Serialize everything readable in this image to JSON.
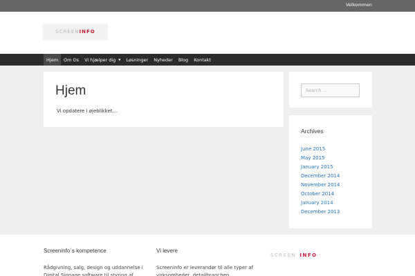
{
  "topbar": {
    "welcome_link": "Velkommen"
  },
  "logo": {
    "part1": "SCREEN",
    "part2": "INFO"
  },
  "nav": {
    "items": [
      {
        "label": "Hjem"
      },
      {
        "label": "Om Os"
      },
      {
        "label": "Vi hjælper dig"
      },
      {
        "label": "Løsninger"
      },
      {
        "label": "Nyheder"
      },
      {
        "label": "Blog"
      },
      {
        "label": "Kontakt"
      }
    ],
    "active": "Hjem",
    "caret": "▼"
  },
  "main": {
    "title": "Hjem",
    "body": "Vi opdatere i øjeblikket..."
  },
  "sidebar": {
    "search": {
      "placeholder": "Search ..."
    },
    "archives": {
      "title": "Archives",
      "items": [
        "June 2015",
        "May 2015",
        "January 2015",
        "December 2014",
        "November 2014",
        "October 2014",
        "January 2014",
        "December 2013"
      ]
    }
  },
  "footer": {
    "col1": {
      "title": "Screeninfo´s kompetence",
      "text": "Rådgivning, salg, design og uddannelse i Digital Signage software til styring af"
    },
    "col2": {
      "title": "Vi levere",
      "text": "Screeninfo er leverandør til alle typer af virksomheder, detailbranchen"
    },
    "logo": {
      "part1": "SCREEN",
      "part2": "INFO"
    }
  },
  "colors": {
    "accent_red": "#c61e34",
    "link_blue": "#1e73be",
    "nav_bg": "#2b2b2b",
    "topbar_bg": "#666666"
  }
}
